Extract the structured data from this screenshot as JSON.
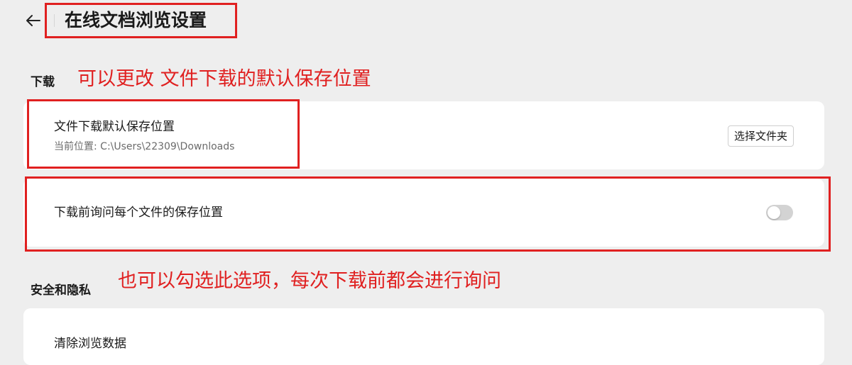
{
  "header": {
    "title": "在线文档浏览设置",
    "back_icon": "arrow-left-icon"
  },
  "sections": {
    "download": {
      "title": "下载",
      "location": {
        "label": "文件下载默认保存位置",
        "current_path": "当前位置: C:\\Users\\22309\\Downloads",
        "button_label": "选择文件夹"
      },
      "ask_before_download": {
        "label": "下载前询问每个文件的保存位置",
        "enabled": false
      }
    },
    "privacy": {
      "title": "安全和隐私",
      "clear_data_label": "清除浏览数据"
    }
  },
  "annotations": {
    "note_1": "可以更改 文件下载的默认保存位置",
    "note_2": "也可以勾选此选项，每次下载前都会进行询问",
    "color": "#e02020"
  },
  "colors": {
    "background": "#eeeeee",
    "card": "#ffffff",
    "toggle_off": "#d3d3d3"
  }
}
